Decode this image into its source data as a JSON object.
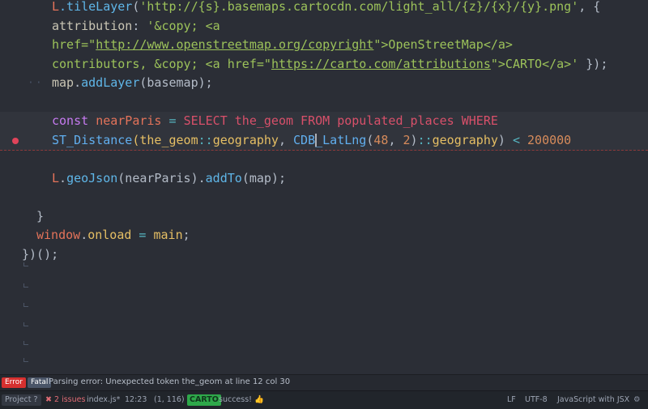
{
  "editor": {
    "lines": [
      [
        [
          "L",
          "t-var"
        ],
        [
          ".tileLayer",
          "t-fn"
        ],
        [
          "(",
          "t-punct"
        ],
        [
          "'http://{s}.basemaps.cartocdn.com/light_all/{z}/{x}/{y}.png'",
          "t-str"
        ],
        [
          ", {",
          "t-punct"
        ]
      ],
      [
        [
          "attribution",
          "t-default"
        ],
        [
          ": ",
          "t-punct"
        ],
        [
          "'&copy; <a",
          "t-str"
        ]
      ],
      [
        [
          "href=\"",
          "t-str"
        ],
        [
          "http://www.openstreetmap.org/copyright",
          "t-strurl"
        ],
        [
          "\">OpenStreetMap</a>",
          "t-str"
        ]
      ],
      [
        [
          "contributors, &copy; <a href=\"",
          "t-str"
        ],
        [
          "https://carto.com/attributions",
          "t-strurl"
        ],
        [
          "\">CARTO</a>'",
          "t-str"
        ],
        [
          " });",
          "t-punct"
        ]
      ],
      [
        [
          "map",
          "t-default"
        ],
        [
          ".",
          "t-punct"
        ],
        [
          "addLayer",
          "t-fn"
        ],
        [
          "(basemap);",
          "t-punct"
        ]
      ],
      [],
      [
        [
          "const ",
          "t-kw"
        ],
        [
          "nearParis",
          "t-var"
        ],
        [
          " = ",
          "t-op"
        ],
        [
          "SELECT the_geom FROM populated_places WHERE",
          "t-sql"
        ]
      ],
      [
        [
          "ST_Distance",
          "t-sqlfn"
        ],
        [
          "(the_geom",
          "t-prop"
        ],
        [
          "::",
          "t-op"
        ],
        [
          "geography",
          "t-prop"
        ],
        [
          ", ",
          "t-punct"
        ],
        [
          "CDB_LatLng",
          "t-sqlfn"
        ],
        [
          "(",
          "t-punct"
        ],
        [
          "48",
          "t-num"
        ],
        [
          ", ",
          "t-punct"
        ],
        [
          "2",
          "t-num"
        ],
        [
          ")",
          "t-punct"
        ],
        [
          "::",
          "t-op"
        ],
        [
          "geography",
          "t-prop"
        ],
        [
          ")",
          "t-punct"
        ],
        [
          " < ",
          "t-op"
        ],
        [
          "200000",
          "t-num"
        ]
      ],
      [],
      [
        [
          "L",
          "t-var"
        ],
        [
          ".",
          "t-punct"
        ],
        [
          "geoJson",
          "t-fn"
        ],
        [
          "(nearParis).",
          "t-punct"
        ],
        [
          "addTo",
          "t-fn"
        ],
        [
          "(map);",
          "t-punct"
        ]
      ],
      [],
      [
        [
          "}",
          "t-punct"
        ]
      ],
      [
        [
          "window",
          "t-var"
        ],
        [
          ".",
          "t-punct"
        ],
        [
          "onload",
          "t-prop"
        ],
        [
          " = ",
          "t-op"
        ],
        [
          "main",
          "t-prop"
        ],
        [
          ";",
          "t-punct"
        ]
      ],
      [
        [
          "})();",
          "t-punct"
        ]
      ]
    ]
  },
  "linter": {
    "error_badge": "Error",
    "fatal_badge": "Fatal",
    "message": "Parsing error: Unexpected token the_geom at line 12 col 30"
  },
  "status_bar": {
    "project_label": "Project",
    "project_help": "?",
    "issues": "2 issues",
    "file": "index.js*",
    "line_col": "12:23",
    "selection": "(1, 116)",
    "carto_badge": "CARTO",
    "carto_status": "success!",
    "line_ending": "LF",
    "encoding": "UTF-8",
    "grammar": "JavaScript with JSX"
  },
  "colors": {
    "error": "#d6302f",
    "fatal": "#4a5568",
    "carto": "#2ea84a"
  },
  "icons": {
    "issues": "x-circle-icon",
    "thumbs_up": "thumbs-up-icon",
    "settings": "settings-gear-icon"
  }
}
